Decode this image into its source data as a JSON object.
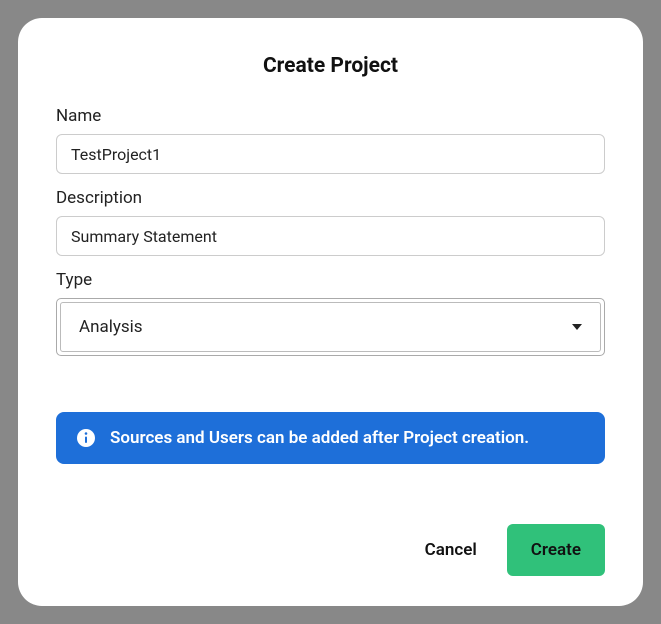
{
  "modal": {
    "title": "Create Project"
  },
  "form": {
    "name": {
      "label": "Name",
      "value": "TestProject1"
    },
    "description": {
      "label": "Description",
      "value": "Summary Statement"
    },
    "type": {
      "label": "Type",
      "selected": "Analysis"
    }
  },
  "info": {
    "message": "Sources and Users can be added after Project creation."
  },
  "buttons": {
    "cancel": "Cancel",
    "create": "Create"
  }
}
